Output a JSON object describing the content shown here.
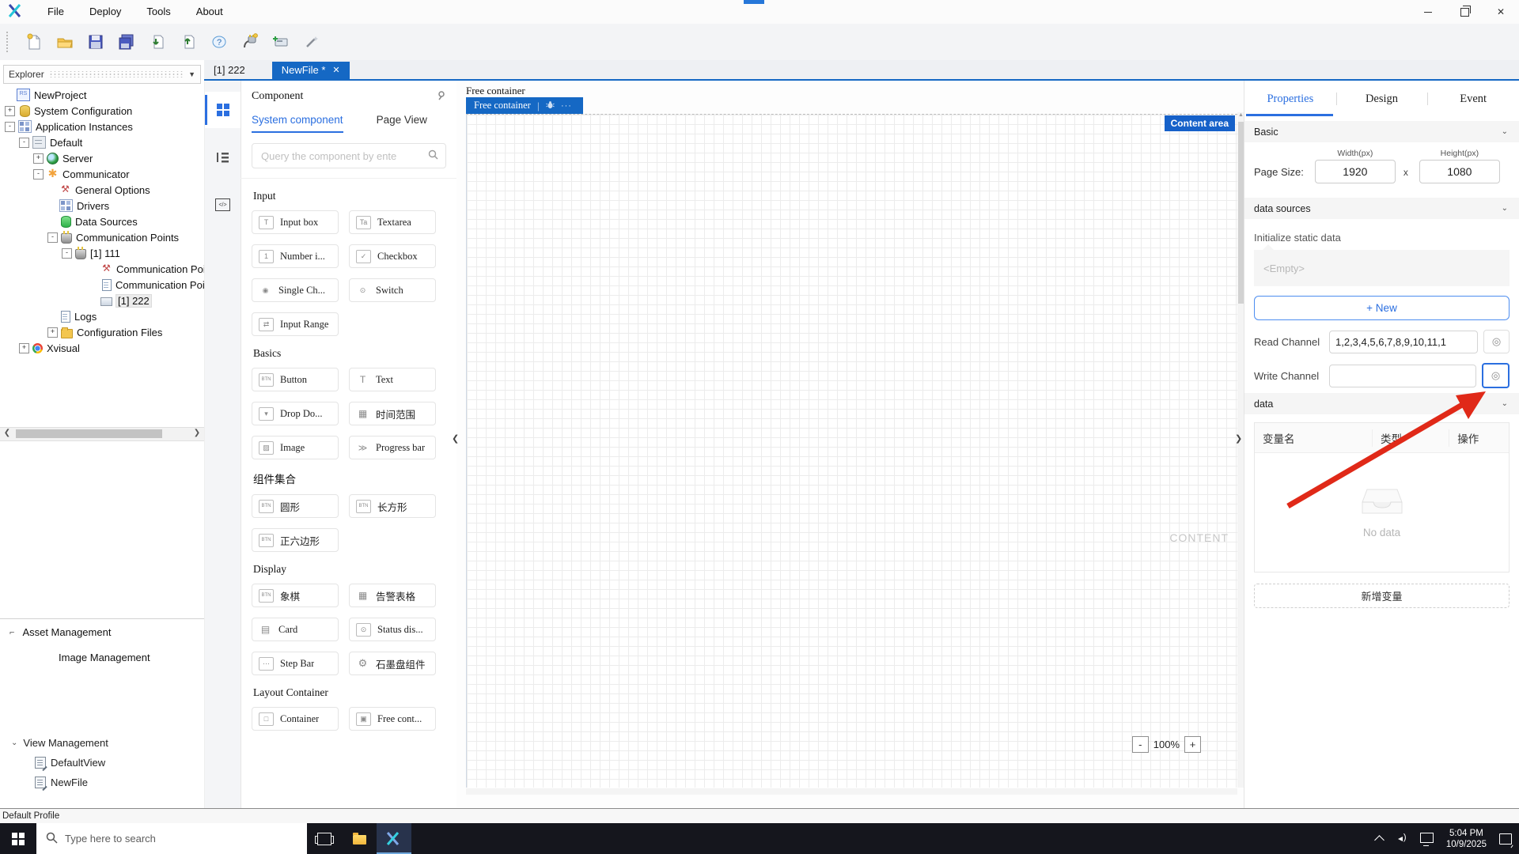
{
  "colors": {
    "accent": "#1568c4",
    "tab_blue": "#2b6fe0",
    "badge_blue": "#1661c9",
    "arrow_red": "#e02918"
  },
  "window": {
    "menu": [
      {
        "label": "File"
      },
      {
        "label": "Deploy"
      },
      {
        "label": "Tools"
      },
      {
        "label": "About"
      }
    ],
    "controls": {
      "close_glyph": "✕"
    }
  },
  "toolbar": {
    "icons": [
      "new-file",
      "open",
      "save",
      "save-all",
      "import",
      "export",
      "help",
      "connect",
      "add-device",
      "wand"
    ]
  },
  "explorer": {
    "title": "Explorer",
    "tree": [
      {
        "label": "NewProject",
        "expander": ""
      },
      {
        "label": "System Configuration",
        "expander": "+"
      },
      {
        "label": "Application Instances",
        "expander": "-"
      },
      {
        "label": "Default",
        "expander": "-"
      },
      {
        "label": "Server",
        "expander": "+"
      },
      {
        "label": "Communicator",
        "expander": "-"
      },
      {
        "label": "General Options",
        "expander": ""
      },
      {
        "label": "Drivers",
        "expander": ""
      },
      {
        "label": "Data Sources",
        "expander": ""
      },
      {
        "label": "Communication Points",
        "expander": "-"
      },
      {
        "label": "[1] 111",
        "expander": "-"
      },
      {
        "label": "Communication Poin",
        "expander": ""
      },
      {
        "label": "Communication Poin",
        "expander": ""
      },
      {
        "label": "[1] 222",
        "expander": ""
      },
      {
        "label": "Logs",
        "expander": ""
      },
      {
        "label": "Configuration Files",
        "expander": "+"
      },
      {
        "label": "Xvisual",
        "expander": "+"
      }
    ]
  },
  "view_management": {
    "title": "View Management",
    "chevron": "⌄",
    "items": [
      {
        "label": "DefaultView"
      },
      {
        "label": "NewFile"
      }
    ]
  },
  "asset_management": {
    "title": "Asset Management",
    "sub": "Image Management",
    "dock_glyph": "⌐"
  },
  "doc_tabs": {
    "tab1": "[1] 222",
    "tab2": "NewFile *",
    "close": "✕"
  },
  "component_panel": {
    "title": "Component",
    "tabs": {
      "system": "System component",
      "page": "Page View"
    },
    "search_placeholder": "Query the component by ente",
    "sections": [
      {
        "title": "Input",
        "items": [
          {
            "label": "Input box",
            "glyph": "T"
          },
          {
            "label": "Textarea",
            "glyph": "Ta"
          },
          {
            "label": "Number i...",
            "glyph": "1"
          },
          {
            "label": "Checkbox",
            "glyph": "✓"
          },
          {
            "label": "Single Ch...",
            "glyph": "◉"
          },
          {
            "label": "Switch",
            "glyph": "⊙"
          },
          {
            "label": "Input Range",
            "glyph": "⇄"
          }
        ]
      },
      {
        "title": "Basics",
        "items": [
          {
            "label": "Button",
            "glyph": "BTN"
          },
          {
            "label": "Text",
            "glyph": "T"
          },
          {
            "label": "Drop Do...",
            "glyph": "▾"
          },
          {
            "label": "时间范围",
            "glyph": "▦"
          },
          {
            "label": "Image",
            "glyph": "▨"
          },
          {
            "label": "Progress bar",
            "glyph": "≫"
          }
        ]
      },
      {
        "title": "组件集合",
        "items": [
          {
            "label": "圆形",
            "glyph": "BTN"
          },
          {
            "label": "长方形",
            "glyph": "BTN"
          },
          {
            "label": "正六边形",
            "glyph": "BTN"
          }
        ]
      },
      {
        "title": "Display",
        "items": [
          {
            "label": "象棋",
            "glyph": "BTN"
          },
          {
            "label": "告警表格",
            "glyph": "▦"
          },
          {
            "label": "Card",
            "glyph": "▤"
          },
          {
            "label": "Status dis...",
            "glyph": "⊙"
          },
          {
            "label": "Step Bar",
            "glyph": "⋯"
          },
          {
            "label": "石墨盘组件",
            "glyph": "⚙"
          }
        ]
      },
      {
        "title": "Layout Container",
        "items": [
          {
            "label": "Container",
            "glyph": "□"
          },
          {
            "label": "Free cont...",
            "glyph": "▣"
          }
        ]
      }
    ]
  },
  "canvas": {
    "outer_label": "Free container",
    "tab_label": "Free container",
    "tab_dots": "···",
    "badge": "Content area",
    "watermark": "CONTENT",
    "zoom": {
      "minus": "-",
      "level": "100%",
      "plus": "+"
    }
  },
  "properties_panel": {
    "tabs": {
      "properties": "Properties",
      "design": "Design",
      "event": "Event"
    },
    "basic": {
      "header": "Basic",
      "page_size_label": "Page Size:",
      "width_label": "Width(px)",
      "width_value": "1920",
      "x_label": "x",
      "height_label": "Height(px)",
      "height_value": "1080"
    },
    "data_sources": {
      "header": "data sources",
      "init_label": "Initialize static data",
      "empty_text": "<Empty>",
      "new_button": "+ New",
      "read_label": "Read Channel",
      "read_value": "1,2,3,4,5,6,7,8,9,10,11,1",
      "write_label": "Write Channel",
      "write_value": ""
    },
    "data": {
      "header": "data",
      "columns": [
        "变量名",
        "类型",
        "操作"
      ],
      "empty_text": "No data",
      "add_button": "新增变量"
    }
  },
  "status_bar": {
    "text": "Default Profile"
  },
  "taskbar": {
    "search_placeholder": "Type here to search",
    "time": "5:04 PM",
    "date": "10/9/2025"
  }
}
